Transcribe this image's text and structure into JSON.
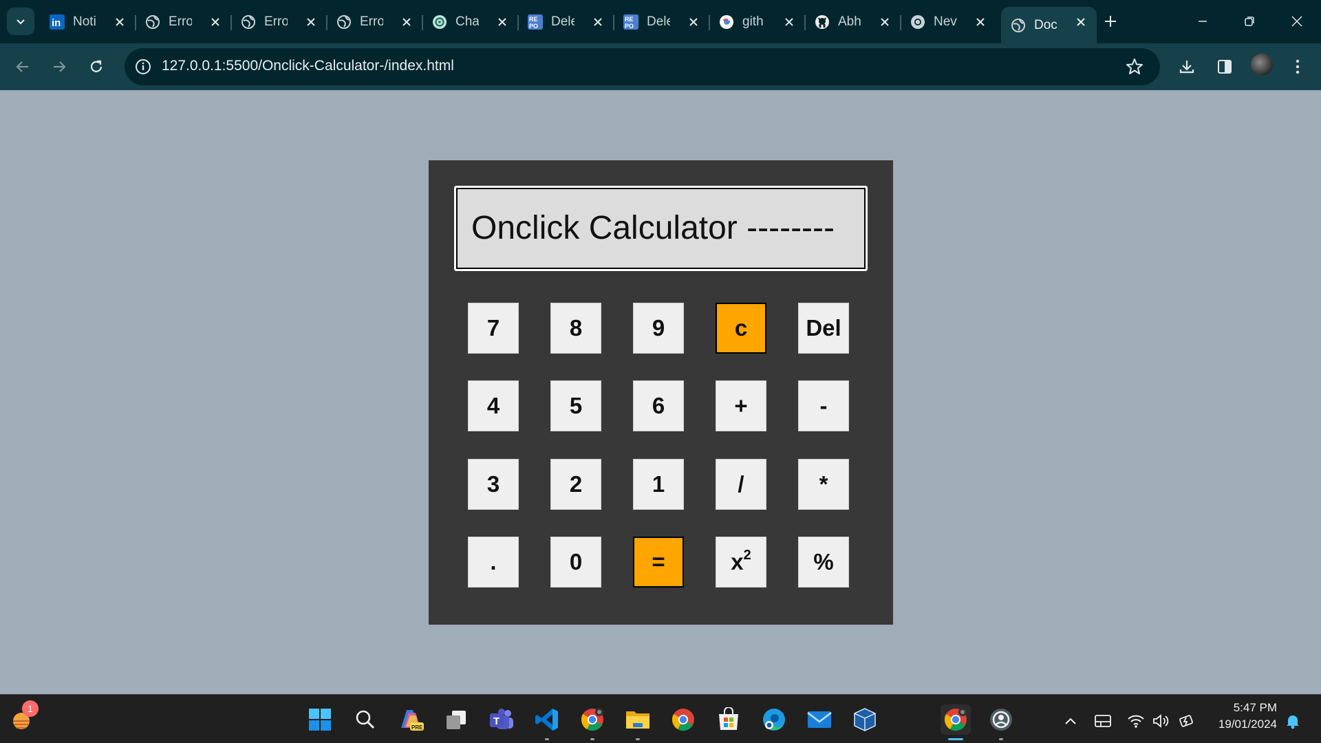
{
  "browser": {
    "tabs": [
      {
        "title": "Noti",
        "icon": "linkedin-icon"
      },
      {
        "title": "Erro",
        "icon": "globe-icon"
      },
      {
        "title": "Erro",
        "icon": "globe-icon"
      },
      {
        "title": "Erro",
        "icon": "globe-icon"
      },
      {
        "title": "Cha",
        "icon": "chatgpt-icon"
      },
      {
        "title": "Dele",
        "icon": "repo-icon"
      },
      {
        "title": "Dele",
        "icon": "repo-icon"
      },
      {
        "title": "gith",
        "icon": "google-icon"
      },
      {
        "title": "Abh",
        "icon": "github-icon"
      },
      {
        "title": "Nev",
        "icon": "chrome-icon"
      },
      {
        "title": "Doc",
        "icon": "globe-icon",
        "active": true
      }
    ],
    "url": "127.0.0.1:5500/Onclick-Calculator-/index.html"
  },
  "calculator": {
    "display": "Onclick Calculator --------",
    "keys": {
      "k7": "7",
      "k8": "8",
      "k9": "9",
      "kc": "c",
      "kdel": "Del",
      "k4": "4",
      "k5": "5",
      "k6": "6",
      "kplus": "+",
      "kminus": "-",
      "k3": "3",
      "k2": "2",
      "k1": "1",
      "kdiv": "/",
      "kmul": "*",
      "kdot": ".",
      "k0": "0",
      "keq": "=",
      "ksq_base": "x",
      "ksq_exp": "2",
      "kpct": "%"
    },
    "accent_color": "#ffa500",
    "background": "#383838"
  },
  "taskbar": {
    "notification_badge": "1",
    "time": "5:47 PM",
    "date": "19/01/2024",
    "pinned": [
      "weather-icon",
      "start-icon",
      "search-icon",
      "copilot-icon",
      "task-view-icon",
      "teams-icon",
      "vscode-icon",
      "chrome-icon",
      "file-explorer-icon",
      "chrome-icon",
      "microsoft-store-icon",
      "edge-icon",
      "mail-icon",
      "virtualbox-icon",
      "chrome-icon",
      "github-desktop-icon"
    ]
  }
}
